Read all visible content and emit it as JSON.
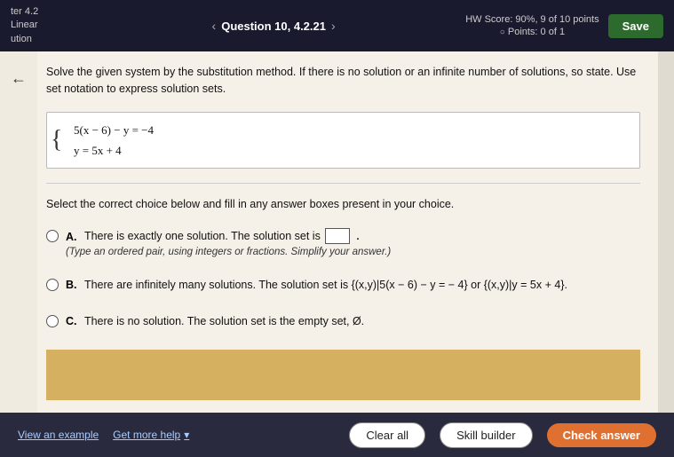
{
  "topbar": {
    "chapter": "ter 4.2",
    "section": "Linear",
    "subsection": "ution",
    "question_label": "Question 10, 4.2.21",
    "hw_score": "HW Score: 90%, 9 of 10 points",
    "points": "Points: 0 of 1",
    "save_label": "Save"
  },
  "problem": {
    "instruction": "Solve the given system by the substitution method. If there is no solution or an infinite number of solutions, so state. Use set notation to express solution sets.",
    "equations": [
      "5(x − 6) − y = −4",
      "y = 5x + 4"
    ],
    "select_label": "Select the correct choice below and fill in any answer boxes present in your choice."
  },
  "options": [
    {
      "id": "A",
      "main": "There is exactly one solution. The solution set is",
      "sub": "(Type an ordered pair, using integers or fractions. Simplify your answer.)"
    },
    {
      "id": "B",
      "main": "There are infinitely many solutions. The solution set is {(x,y)|5(x − 6) − y = − 4} or {(x,y)|y = 5x + 4}."
    },
    {
      "id": "C",
      "main": "There is no solution. The solution set is the empty set, Ø."
    }
  ],
  "bottom": {
    "view_example": "View an example",
    "get_more_help": "Get more help ",
    "chevron": "▾",
    "clear_all": "Clear all",
    "skill_builder": "Skill builder",
    "check_answer": "Check answer"
  }
}
